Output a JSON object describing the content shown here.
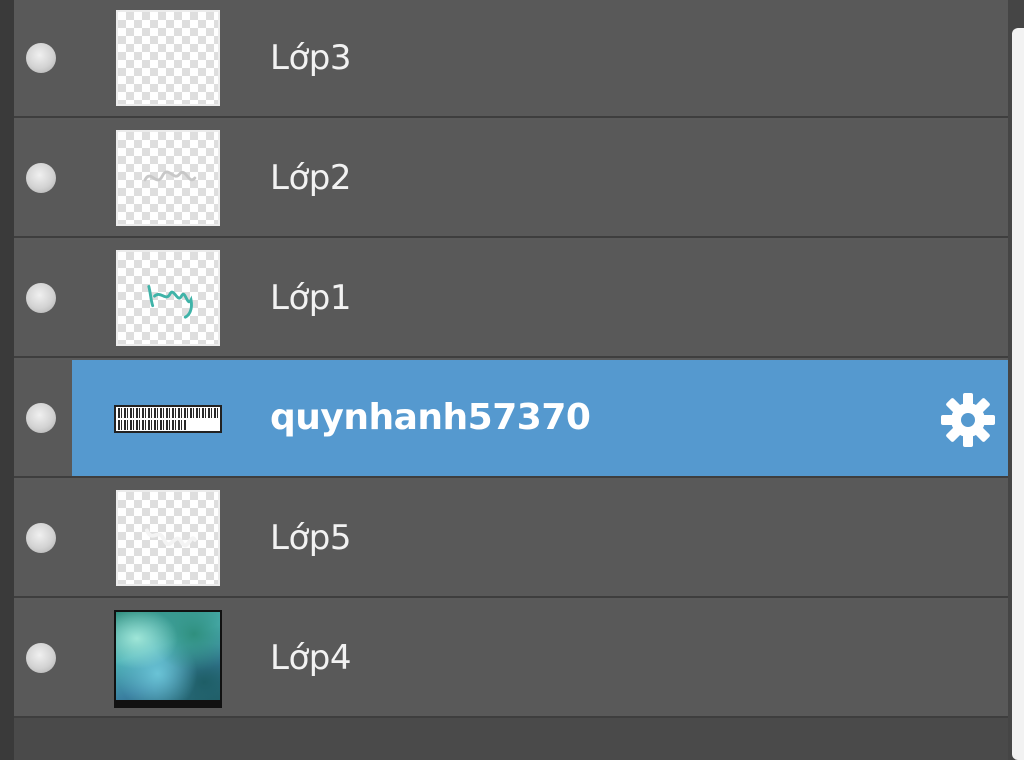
{
  "layers_panel": {
    "layers": [
      {
        "name": "Lớp3",
        "thumbnail": "transparent",
        "selected": false,
        "visible": true
      },
      {
        "name": "Lớp2",
        "thumbnail": "transparent-faint-text",
        "selected": false,
        "visible": true
      },
      {
        "name": "Lớp1",
        "thumbnail": "transparent-teal-text",
        "selected": false,
        "visible": true
      },
      {
        "name": "quynhanh57370",
        "thumbnail": "text-strip",
        "selected": true,
        "visible": true
      },
      {
        "name": "Lớp5",
        "thumbnail": "transparent-faint-text",
        "selected": false,
        "visible": true
      },
      {
        "name": "Lớp4",
        "thumbnail": "photo",
        "selected": false,
        "visible": true
      }
    ],
    "icons": {
      "visibility": "eye-dot-icon",
      "settings": "gear-icon"
    },
    "colors": {
      "panel_bg": "#595959",
      "selected_bg": "#5599cf",
      "text": "#f2f2f2",
      "divider": "#3e3e3e"
    }
  }
}
